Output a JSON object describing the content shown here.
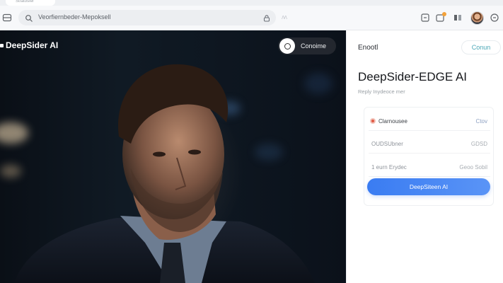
{
  "browser": {
    "tabs": [
      {
        "label": "Stratosfer"
      },
      {
        "label": ""
      }
    ],
    "omnibox": {
      "value": "Veorfiernbeder-Mepoksell"
    },
    "extension_hint": "ʌʌ"
  },
  "hero": {
    "logo": "DeepSider AI",
    "pill_label": "Conoime"
  },
  "panel": {
    "title": "Enootl",
    "connect_label": "Conun",
    "heading": "DeepSider-EDGE AI",
    "subtitle": "Reply Inydeoce mer",
    "rows": [
      {
        "label": "Clarnousee",
        "value": "Ctov"
      },
      {
        "label": "OUDSUbner",
        "value": "GDSD"
      },
      {
        "label": "1 eurn Erydec",
        "value": "Geoo Sobil"
      }
    ],
    "cta_label": "DeepSiteen AI"
  },
  "colors": {
    "accent": "#3a7cf2",
    "connect": "#4aa7b6",
    "badge": "#f3a23a"
  }
}
